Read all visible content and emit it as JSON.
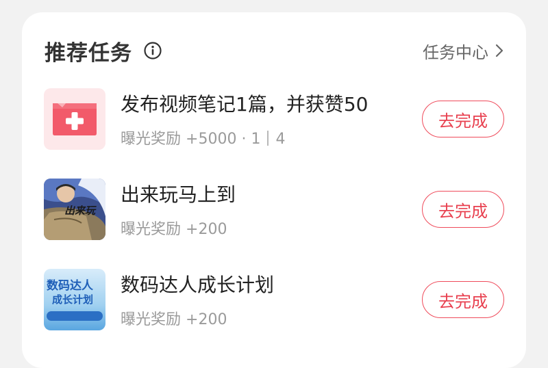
{
  "header": {
    "title": "推荐任务",
    "center_link": "任务中心"
  },
  "tasks": [
    {
      "title": "发布视频笔记1篇，并获赞50",
      "reward_label": "曝光奖励",
      "reward_value": "+5000",
      "progress_done": "1",
      "progress_total": "4",
      "button": "去完成",
      "icon": "video-play-icon"
    },
    {
      "title": "出来玩马上到",
      "reward_label": "曝光奖励",
      "reward_value": "+200",
      "button": "去完成",
      "icon": "photo-thumbnail",
      "thumb_text": "出来玩"
    },
    {
      "title": "数码达人成长计划",
      "reward_label": "曝光奖励",
      "reward_value": "+200",
      "button": "去完成",
      "icon": "poster-thumbnail",
      "thumb_text_1": "数码达人",
      "thumb_text_2": "成长计划"
    }
  ],
  "colors": {
    "accent": "#ef4a5a",
    "title": "#333333",
    "muted": "#9a9a9a"
  }
}
